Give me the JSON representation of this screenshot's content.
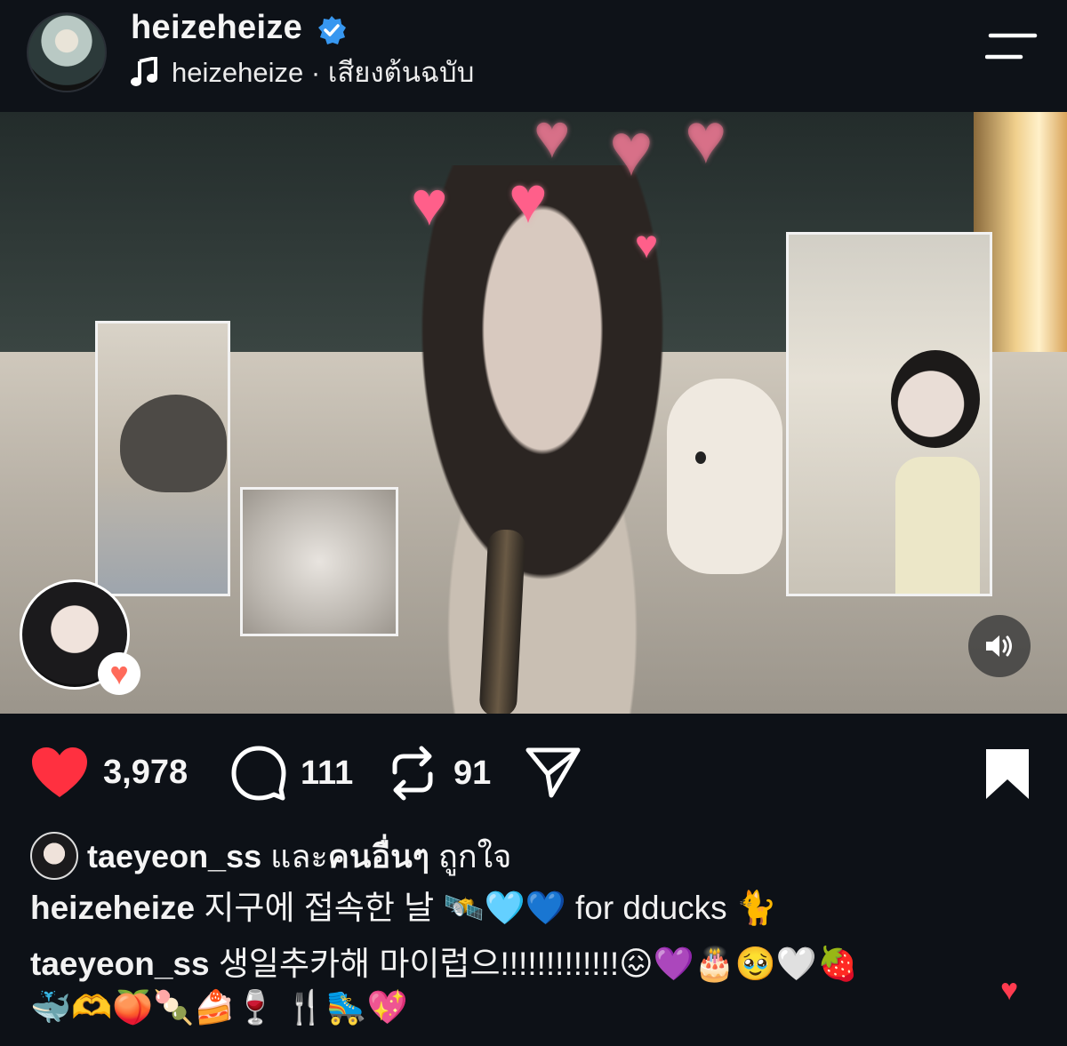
{
  "header": {
    "username": "heizeheize",
    "audio_text": "heizeheize · เสียงต้นฉบับ",
    "icons": [
      "verified-badge-icon",
      "music-note-icon",
      "menu-icon"
    ]
  },
  "media": {
    "icons": [
      "heart-sticker-icon",
      "volume-icon"
    ]
  },
  "actions": {
    "likes": "3,978",
    "comments": "111",
    "reposts": "91",
    "icons": [
      "heart-icon",
      "comment-icon",
      "repost-icon",
      "share-icon",
      "bookmark-icon"
    ],
    "colors": {
      "like": "#ff3040"
    }
  },
  "liked_by": {
    "user": "taeyeon_ss",
    "text_plain": "และ",
    "text_bold": "คนอื่นๆ",
    "text_end": "ถูกใจ"
  },
  "caption": {
    "user": "heizeheize",
    "text": "지구에 접속한 날 🛰️🩵💙 for dducks 🐈"
  },
  "comment": {
    "user": "taeyeon_ss",
    "text_line1": "생일추카해 마이럽으!!!!!!!!!!!!!😖💜🎂🥹🤍🍓",
    "text_line2": "🐳🫶🍑🍡🍰🍷 🍴🛼💖"
  }
}
